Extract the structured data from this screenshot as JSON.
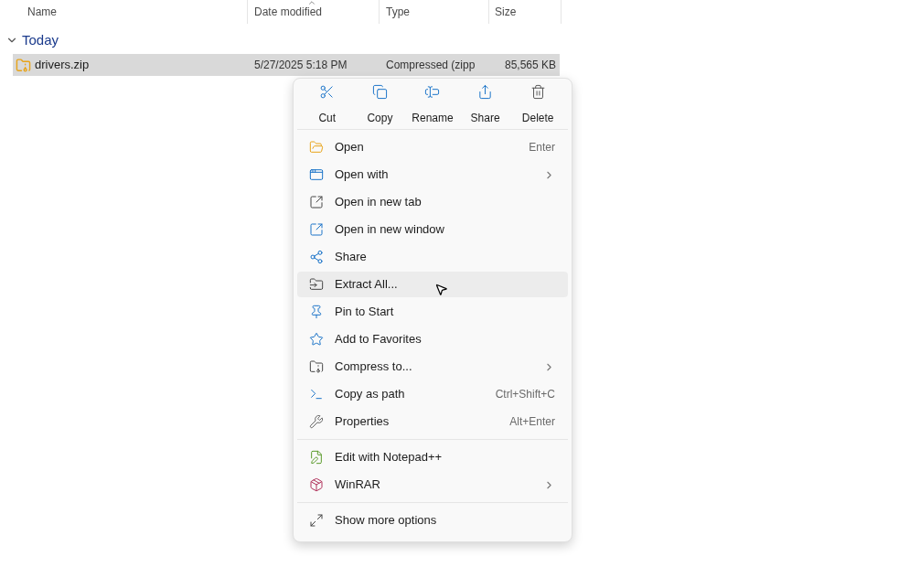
{
  "columns": [
    "Name",
    "Date modified",
    "Type",
    "Size"
  ],
  "group": {
    "label": "Today",
    "expanded": true
  },
  "files": [
    {
      "name": "drivers.zip",
      "date": "5/27/2025 5:18 PM",
      "type": "Compressed (zipp",
      "size": "85,565 KB",
      "selected": true
    }
  ],
  "context_menu": {
    "actions": [
      "Cut",
      "Copy",
      "Rename",
      "Share",
      "Delete"
    ],
    "sections": [
      [
        {
          "label": "Open",
          "shortcut": "Enter",
          "submenu": false,
          "highlighted": false
        },
        {
          "label": "Open with",
          "submenu": true,
          "highlighted": false
        },
        {
          "label": "Open in new tab",
          "submenu": false,
          "highlighted": false
        },
        {
          "label": "Open in new window",
          "submenu": false,
          "highlighted": false
        },
        {
          "label": "Share",
          "submenu": false,
          "highlighted": false
        },
        {
          "label": "Extract All...",
          "submenu": false,
          "highlighted": true
        },
        {
          "label": "Pin to Start",
          "submenu": false,
          "highlighted": false
        },
        {
          "label": "Add to Favorites",
          "submenu": false,
          "highlighted": false
        },
        {
          "label": "Compress to...",
          "submenu": true,
          "highlighted": false
        },
        {
          "label": "Copy as path",
          "shortcut": "Ctrl+Shift+C",
          "submenu": false,
          "highlighted": false
        },
        {
          "label": "Properties",
          "shortcut": "Alt+Enter",
          "submenu": false,
          "highlighted": false
        }
      ],
      [
        {
          "label": "Edit with Notepad++",
          "submenu": false,
          "highlighted": false
        },
        {
          "label": "WinRAR",
          "submenu": true,
          "highlighted": false
        }
      ],
      [
        {
          "label": "Show more options",
          "submenu": false,
          "highlighted": false
        }
      ]
    ]
  }
}
